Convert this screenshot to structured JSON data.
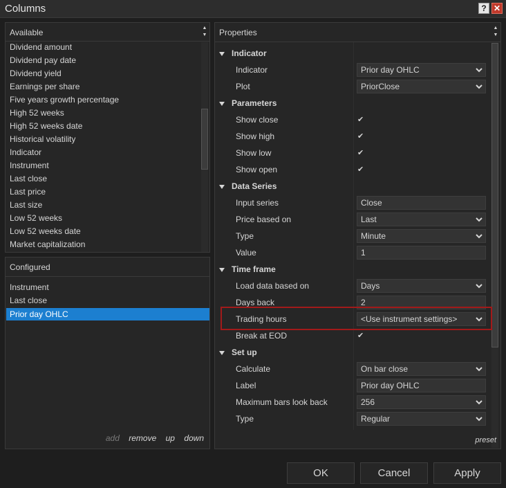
{
  "window": {
    "title": "Columns",
    "help_label": "?",
    "close_label": "✕"
  },
  "available": {
    "header": "Available",
    "items": [
      "Dividend amount",
      "Dividend pay date",
      "Dividend yield",
      "Earnings per share",
      "Five years growth percentage",
      "High 52 weeks",
      "High 52 weeks date",
      "Historical volatility",
      "Indicator",
      "Instrument",
      "Last close",
      "Last price",
      "Last size",
      "Low 52 weeks",
      "Low 52 weeks date",
      "Market capitalization"
    ]
  },
  "configured": {
    "header": "Configured",
    "items": [
      "Instrument",
      "Last close",
      "Prior day OHLC"
    ],
    "selected": "Prior day OHLC",
    "actions": {
      "add": "add",
      "remove": "remove",
      "up": "up",
      "down": "down"
    }
  },
  "properties": {
    "header": "Properties",
    "categories": {
      "indicator": "Indicator",
      "parameters": "Parameters",
      "data_series": "Data Series",
      "time_frame": "Time frame",
      "set_up": "Set up"
    },
    "rows": {
      "indicator": {
        "label": "Indicator",
        "value": "Prior day OHLC"
      },
      "plot": {
        "label": "Plot",
        "value": "PriorClose"
      },
      "show_close": {
        "label": "Show close",
        "value": "✔"
      },
      "show_high": {
        "label": "Show high",
        "value": "✔"
      },
      "show_low": {
        "label": "Show low",
        "value": "✔"
      },
      "show_open": {
        "label": "Show open",
        "value": "✔"
      },
      "input_series": {
        "label": "Input series",
        "value": "Close"
      },
      "price_based_on": {
        "label": "Price based on",
        "value": "Last"
      },
      "type": {
        "label": "Type",
        "value": "Minute"
      },
      "value": {
        "label": "Value",
        "value": "1"
      },
      "load_data_based_on": {
        "label": "Load data based on",
        "value": "Days"
      },
      "days_back": {
        "label": "Days back",
        "value": "2"
      },
      "trading_hours": {
        "label": "Trading hours",
        "value": "<Use instrument settings>"
      },
      "break_at_eod": {
        "label": "Break at EOD",
        "value": "✔"
      },
      "calculate": {
        "label": "Calculate",
        "value": "On bar close"
      },
      "label": {
        "label": "Label",
        "value": "Prior day OHLC"
      },
      "max_bars_look_back": {
        "label": "Maximum bars look back",
        "value": "256"
      },
      "setup_type": {
        "label": "Type",
        "value": "Regular"
      }
    },
    "preset": "preset"
  },
  "buttons": {
    "ok": "OK",
    "cancel": "Cancel",
    "apply": "Apply"
  },
  "colors": {
    "selection": "#1c7fd0",
    "highlight_box": "#a21a1a",
    "close_button": "#c0392b"
  }
}
